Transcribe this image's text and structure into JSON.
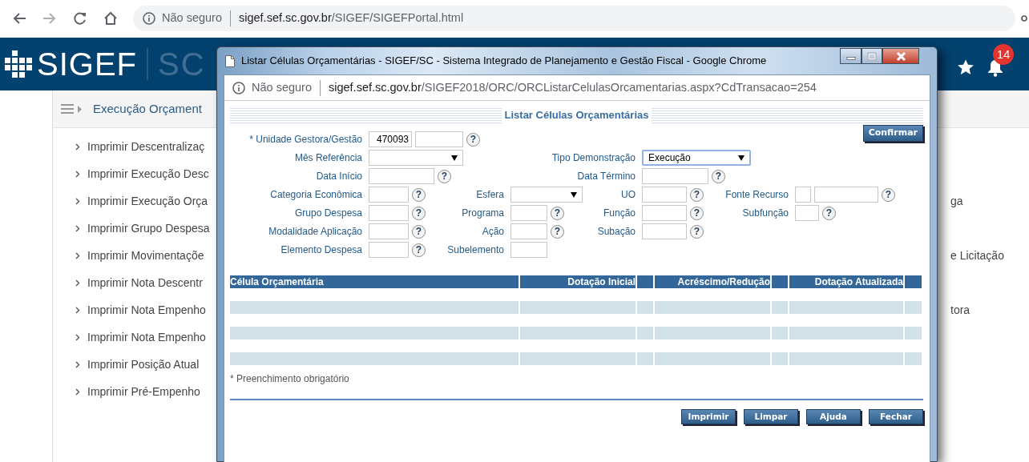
{
  "browser": {
    "buttons": [
      {
        "kind": "back",
        "disabled": false
      },
      {
        "kind": "forward",
        "disabled": true
      },
      {
        "kind": "reload",
        "disabled": false
      },
      {
        "kind": "home",
        "disabled": false
      }
    ],
    "address": {
      "security": "Não seguro",
      "host": "sigef.sef.sc.gov.br",
      "path": "/SIGEF/SIGEFPortal.html"
    }
  },
  "header": {
    "logo": "SIGEF",
    "region": "SC",
    "notifications": "14"
  },
  "breadcrumb": "Execução Orçament",
  "menu": {
    "left": [
      "Imprimir Descentralizaç",
      "Imprimir Execução Desc",
      "Imprimir Execução Orça",
      "Imprimir Grupo Despesa",
      "Imprimir Movimentaçõe",
      "Imprimir Nota Descentr",
      "Imprimir Nota Empenho",
      "Imprimir Nota Empenho",
      "Imprimir Posição Atual",
      "Imprimir Pré-Empenho"
    ],
    "right": [
      "ga",
      "e Licitação",
      "tora"
    ]
  },
  "popup": {
    "title": "Listar Células Orçamentárias - SIGEF/SC - Sistema Integrado de Planejamento e Gestão Fiscal - Google Chrome",
    "address": {
      "security": "Não seguro",
      "host": "sigef.sef.sc.gov.br",
      "path": "/SIGEF2018/ORC/ORCListarCelulasOrcamentarias.aspx?CdTransacao=254"
    },
    "heading": "Listar Células Orçamentárias",
    "confirm": "Confirmar",
    "rows": [
      [
        {
          "label": "* Unidade Gestora/Gestão",
          "fields": [
            {
              "kind": "text",
              "value": "470093"
            },
            {
              "kind": "text"
            }
          ],
          "help": "?"
        }
      ],
      [
        {
          "label": "Mês Referência",
          "fields": [
            {
              "kind": "select",
              "focused": false
            }
          ]
        },
        {
          "label": "Tipo Demonstração",
          "fields": [
            {
              "kind": "select",
              "value": "Execução",
              "focused": true
            }
          ]
        }
      ],
      [
        {
          "label": "Data Início",
          "fields": [
            {
              "kind": "text"
            }
          ],
          "help": "?"
        },
        {
          "label": "Data Término",
          "fields": [
            {
              "kind": "text"
            }
          ],
          "help": "?"
        }
      ],
      [
        {
          "label": "Categoria Econômica",
          "fields": [
            {
              "kind": "text"
            }
          ],
          "help": "?"
        },
        {
          "label": "Esfera",
          "fields": [
            {
              "kind": "select",
              "focused": false
            }
          ]
        },
        {
          "label": "UO",
          "fields": [
            {
              "kind": "text"
            }
          ],
          "help": "?"
        },
        {
          "label": "Fonte Recurso",
          "fields": [
            {
              "kind": "text"
            },
            {
              "kind": "text"
            }
          ],
          "help": "?"
        }
      ],
      [
        {
          "label": "Grupo Despesa",
          "fields": [
            {
              "kind": "text"
            }
          ],
          "help": "?"
        },
        {
          "label": "Programa",
          "fields": [
            {
              "kind": "text"
            }
          ],
          "help": "?"
        },
        {
          "label": "Função",
          "fields": [
            {
              "kind": "text"
            }
          ],
          "help": "?"
        },
        {
          "label": "Subfunção",
          "fields": [
            {
              "kind": "text"
            }
          ],
          "help": "?"
        }
      ],
      [
        {
          "label": "Modalidade Aplicação",
          "fields": [
            {
              "kind": "text"
            }
          ],
          "help": "?"
        },
        {
          "label": "Ação",
          "fields": [
            {
              "kind": "text"
            }
          ],
          "help": "?"
        },
        {
          "label": "Subação",
          "fields": [
            {
              "kind": "text"
            }
          ],
          "help": "?"
        }
      ],
      [
        {
          "label": "Elemento Despesa",
          "fields": [
            {
              "kind": "text"
            }
          ],
          "help": "?"
        },
        {
          "label": "Subelemento",
          "fields": [
            {
              "kind": "text"
            }
          ]
        }
      ]
    ],
    "table": {
      "columns": [
        "Célula Orçamentária",
        "Dotação Inicial",
        "Acréscimo/Redução",
        "Dotação Atualizada"
      ]
    },
    "note": "* Preenchimento obrigatório",
    "buttons": [
      "Imprimir",
      "Limpar",
      "Ajuda",
      "Fechar"
    ]
  }
}
